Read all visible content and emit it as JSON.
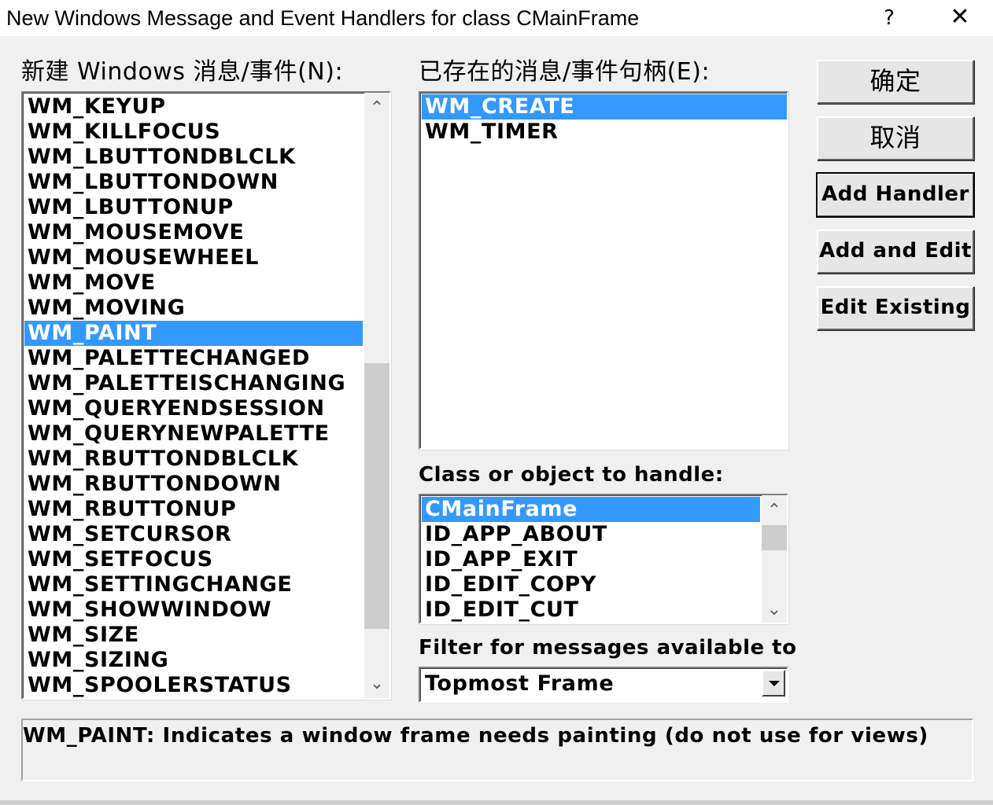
{
  "window": {
    "title": "New Windows Message and Event Handlers for class CMainFrame",
    "help_label": "?",
    "close_label": "✕"
  },
  "new_messages": {
    "label": "新建 Windows 消息/事件(N):",
    "items": [
      "WM_KEYUP",
      "WM_KILLFOCUS",
      "WM_LBUTTONDBLCLK",
      "WM_LBUTTONDOWN",
      "WM_LBUTTONUP",
      "WM_MOUSEMOVE",
      "WM_MOUSEWHEEL",
      "WM_MOVE",
      "WM_MOVING",
      "WM_PAINT",
      "WM_PALETTECHANGED",
      "WM_PALETTEISCHANGING",
      "WM_QUERYENDSESSION",
      "WM_QUERYNEWPALETTE",
      "WM_RBUTTONDBLCLK",
      "WM_RBUTTONDOWN",
      "WM_RBUTTONUP",
      "WM_SETCURSOR",
      "WM_SETFOCUS",
      "WM_SETTINGCHANGE",
      "WM_SHOWWINDOW",
      "WM_SIZE",
      "WM_SIZING",
      "WM_SPOOLERSTATUS"
    ],
    "selected": "WM_PAINT",
    "scroll_up_label": "⌃",
    "scroll_down_label": "⌄"
  },
  "existing_handlers": {
    "label": "已存在的消息/事件句柄(E):",
    "items": [
      "WM_CREATE",
      "WM_TIMER"
    ],
    "selected": "WM_CREATE"
  },
  "class_or_object": {
    "label": "Class or object to handle:",
    "items": [
      "CMainFrame",
      "ID_APP_ABOUT",
      "ID_APP_EXIT",
      "ID_EDIT_COPY",
      "ID_EDIT_CUT"
    ],
    "selected": "CMainFrame",
    "scroll_up_label": "⌃",
    "scroll_down_label": "⌄"
  },
  "filter": {
    "label": "Filter for messages available to",
    "value": "Topmost Frame"
  },
  "buttons": {
    "ok": "确定",
    "cancel": "取消",
    "add_handler": "Add Handler",
    "add_and_edit": "Add and Edit",
    "edit_existing": "Edit Existing"
  },
  "description": "WM_PAINT:  Indicates a window frame needs painting (do not use for views)",
  "colors": {
    "selection": "#3399ff",
    "background": "#f0f0f0"
  }
}
